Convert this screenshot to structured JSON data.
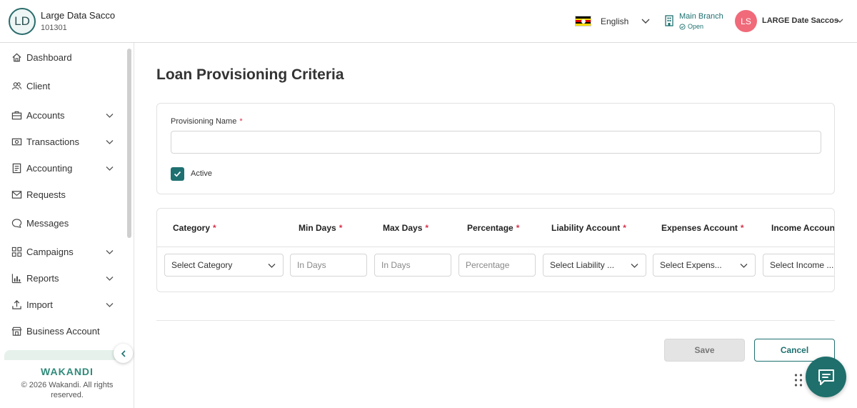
{
  "header": {
    "org_initials": "LD",
    "org_name": "Large Data Sacco",
    "org_code": "101301",
    "language": "English",
    "branch_name": "Main Branch",
    "branch_status": "Open",
    "user_initials": "LS",
    "user_name": "LARGE Date Saccos"
  },
  "sidebar": {
    "items": [
      {
        "label": "Dashboard",
        "icon": "home-icon"
      },
      {
        "label": "Client",
        "icon": "users-icon"
      },
      {
        "label": "Accounts",
        "icon": "briefcase-icon"
      },
      {
        "label": "Transactions",
        "icon": "cash-icon"
      },
      {
        "label": "Accounting",
        "icon": "ledger-icon"
      },
      {
        "label": "Requests",
        "icon": "mail-icon"
      },
      {
        "label": "Messages",
        "icon": "chat-icon"
      },
      {
        "label": "Campaigns",
        "icon": "grid-icon"
      },
      {
        "label": "Reports",
        "icon": "bar-chart-icon"
      },
      {
        "label": "Import",
        "icon": "upload-icon"
      },
      {
        "label": "Business Account",
        "icon": "store-icon"
      }
    ],
    "brand": "WAKANDI",
    "copyright": "© 2026 Wakandi. All rights reserved."
  },
  "main": {
    "title": "Loan Provisioning Criteria",
    "form": {
      "name_label": "Provisioning Name",
      "required_mark": "*",
      "name_value": "",
      "active_label": "Active",
      "active_checked": true
    },
    "table": {
      "columns": [
        {
          "header": "Category",
          "kind": "select",
          "placeholder": "Select Category"
        },
        {
          "header": "Min Days",
          "kind": "input",
          "placeholder": "In Days"
        },
        {
          "header": "Max Days",
          "kind": "input",
          "placeholder": "In Days"
        },
        {
          "header": "Percentage",
          "kind": "input",
          "placeholder": "Percentage"
        },
        {
          "header": "Liability Account",
          "kind": "select",
          "placeholder": "Select Liability ..."
        },
        {
          "header": "Expenses Account",
          "kind": "select",
          "placeholder": "Select Expens..."
        },
        {
          "header": "Income Account",
          "kind": "select",
          "placeholder": "Select Income ..."
        }
      ]
    },
    "save_label": "Save",
    "cancel_label": "Cancel"
  },
  "colors": {
    "accent": "#1f7070",
    "user_avatar": "#f06a7a",
    "required": "#d9304a",
    "brand": "#2f8a7a"
  }
}
